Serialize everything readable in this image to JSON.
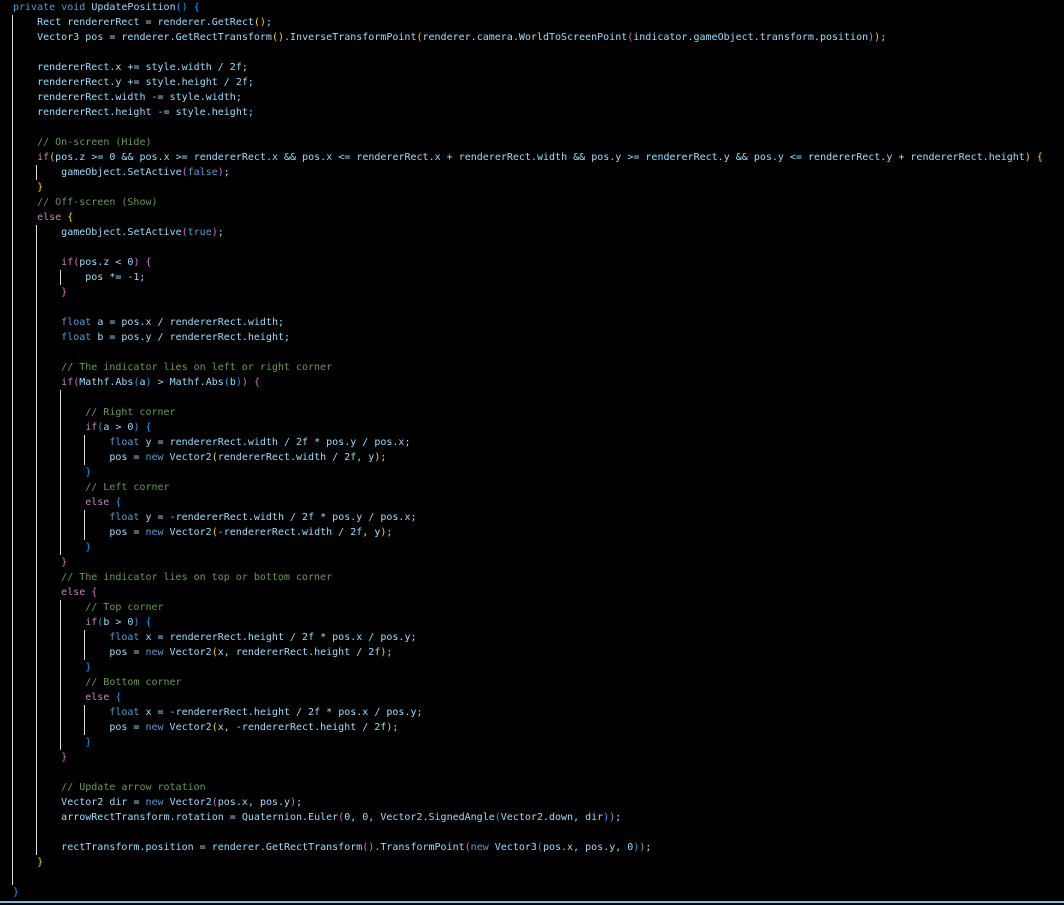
{
  "editor": {
    "lines": [
      "private void UpdatePosition() {",
      "    Rect rendererRect = renderer.GetRect();",
      "    Vector3 pos = renderer.GetRectTransform().InverseTransformPoint(renderer.camera.WorldToScreenPoint(indicator.gameObject.transform.position));",
      "    ",
      "    rendererRect.x += style.width / 2f;",
      "    rendererRect.y += style.height / 2f;",
      "    rendererRect.width -= style.width;",
      "    rendererRect.height -= style.height;",
      "    ",
      "    // On-screen (Hide)",
      "    if(pos.z >= 0 && pos.x >= rendererRect.x && pos.x <= rendererRect.x + rendererRect.width && pos.y >= rendererRect.y && pos.y <= rendererRect.y + rendererRect.height) {",
      "        gameObject.SetActive(false);",
      "    }",
      "    // Off-screen (Show)",
      "    else {",
      "        gameObject.SetActive(true);",
      "        ",
      "        if(pos.z < 0) {",
      "            pos *= -1;",
      "        }",
      "        ",
      "        float a = pos.x / rendererRect.width;",
      "        float b = pos.y / rendererRect.height;",
      "        ",
      "        // The indicator lies on left or right corner",
      "        if(Mathf.Abs(a) > Mathf.Abs(b)) {",
      "            ",
      "            // Right corner",
      "            if(a > 0) {",
      "                float y = rendererRect.width / 2f * pos.y / pos.x;",
      "                pos = new Vector2(rendererRect.width / 2f, y);",
      "            }",
      "            // Left corner",
      "            else {",
      "                float y = -rendererRect.width / 2f * pos.y / pos.x;",
      "                pos = new Vector2(-rendererRect.width / 2f, y);",
      "            }",
      "        }",
      "        // The indicator lies on top or bottom corner",
      "        else {",
      "            // Top corner",
      "            if(b > 0) {",
      "                float x = rendererRect.height / 2f * pos.x / pos.y;",
      "                pos = new Vector2(x, rendererRect.height / 2f);",
      "            }",
      "            // Bottom corner",
      "            else {",
      "                float x = -rendererRect.height / 2f * pos.x / pos.y;",
      "                pos = new Vector2(x, -rendererRect.height / 2f);",
      "            }",
      "        }",
      "        ",
      "        // Update arrow rotation",
      "        Vector2 dir = new Vector2(pos.x, pos.y);",
      "        arrowRectTransform.rotation = Quaternion.Euler(0, 0, Vector2.SignedAngle(Vector2.down, dir));",
      "        ",
      "        rectTransform.position = renderer.GetRectTransform().TransformPoint(new Vector3(pos.x, pos.y, 0));",
      "    }",
      "    ",
      "}"
    ]
  },
  "colors": {
    "background": "#000000",
    "identifier": "#9cdcfe",
    "keyword": "#569cd6",
    "control": "#c586c0",
    "comment": "#6a9955",
    "bracket_levels": [
      "#ffd700",
      "#da70d6",
      "#179fff"
    ]
  }
}
